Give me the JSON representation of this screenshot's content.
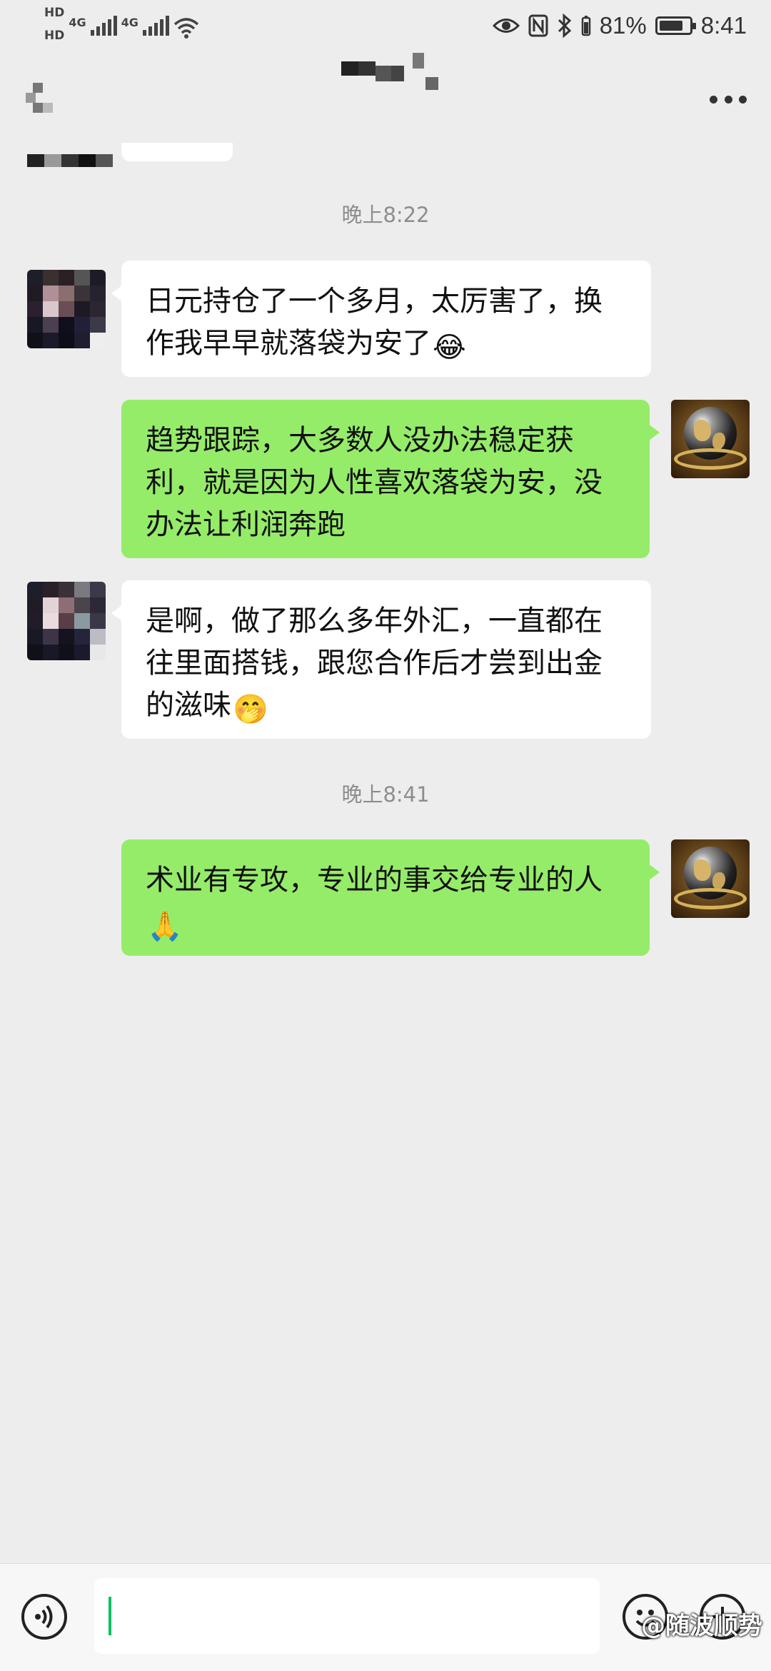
{
  "status_bar": {
    "hd1": "HD",
    "hd2": "HD",
    "net1": "4G",
    "net2": "4G",
    "battery_percent": "81%",
    "battery_level": 0.81,
    "time": "8:41",
    "icons": [
      "wifi-icon",
      "eye-icon",
      "nfc-icon",
      "bluetooth-icon",
      "battery-icon"
    ]
  },
  "header": {
    "title": "",
    "back_icon": "back-arrow-icon",
    "more_icon": "more-dots-icon"
  },
  "messages": [
    {
      "type": "time",
      "text": "晚上8:22"
    },
    {
      "type": "received",
      "text": "日元持仓了一个多月，太厉害了，换作我早早就落袋为安了",
      "emoji": "😂"
    },
    {
      "type": "sent",
      "text": "趋势跟踪，大多数人没办法稳定获利，就是因为人性喜欢落袋为安，没办法让利润奔跑",
      "emoji": ""
    },
    {
      "type": "received",
      "text": "是啊，做了那么多年外汇，一直都在往里面搭钱，跟您合作后才尝到出金的滋味",
      "emoji": "🤭"
    },
    {
      "type": "time",
      "text": "晚上8:41"
    },
    {
      "type": "sent",
      "text": "术业有专攻，专业的事交给专业的人",
      "emoji": "🙏"
    }
  ],
  "input_bar": {
    "voice_icon": "voice-icon",
    "emoji_icon": "emoji-icon",
    "add_icon": "add-icon",
    "value": ""
  },
  "watermark": "@随波顺势",
  "colors": {
    "background": "#ededed",
    "sent_bubble": "#95ec69",
    "received_bubble": "#ffffff",
    "timestamp": "#8d8d8d"
  }
}
